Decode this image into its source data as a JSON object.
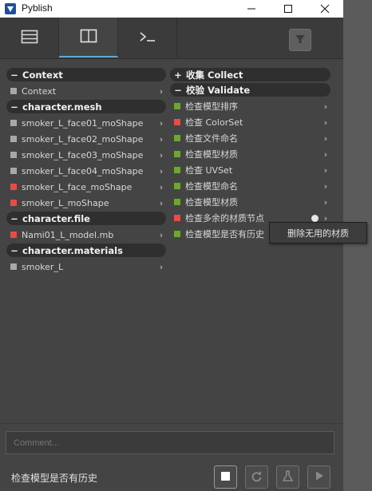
{
  "window": {
    "title": "Pyblish"
  },
  "left": {
    "sections": [
      {
        "label": "Context",
        "items": [
          {
            "label": "Context",
            "status": "gray"
          }
        ]
      },
      {
        "label": "character.mesh",
        "items": [
          {
            "label": "smoker_L_face01_moShape",
            "status": "gray"
          },
          {
            "label": "smoker_L_face02_moShape",
            "status": "gray"
          },
          {
            "label": "smoker_L_face03_moShape",
            "status": "gray"
          },
          {
            "label": "smoker_L_face04_moShape",
            "status": "gray"
          },
          {
            "label": "smoker_L_face_moShape",
            "status": "red"
          },
          {
            "label": "smoker_L_moShape",
            "status": "red"
          }
        ]
      },
      {
        "label": "character.file",
        "items": [
          {
            "label": "Nami01_L_model.mb",
            "status": "red"
          }
        ]
      },
      {
        "label": "character.materials",
        "items": [
          {
            "label": "smoker_L",
            "status": "gray"
          }
        ]
      }
    ]
  },
  "right": {
    "collect_label": "收集 Collect",
    "validate_label": "校验 Validate",
    "items": [
      {
        "label": "检查模型排序",
        "status": "green"
      },
      {
        "label": "检查 ColorSet",
        "status": "red"
      },
      {
        "label": "检查文件命名",
        "status": "green"
      },
      {
        "label": "检查模型材质",
        "status": "green"
      },
      {
        "label": "检查 UVSet",
        "status": "green"
      },
      {
        "label": "检查模型命名",
        "status": "green"
      },
      {
        "label": "检查模型材质",
        "status": "green"
      },
      {
        "label": "检查多余的材质节点",
        "status": "red",
        "info": true
      },
      {
        "label": "检查模型是否有历史",
        "status": "green"
      }
    ]
  },
  "tooltip": {
    "text": "删除无用的材质"
  },
  "comment": {
    "placeholder": "Comment..."
  },
  "status_text": "检查模型是否有历史",
  "colors": {
    "accent": "#5eaad8",
    "fail": "#e74c4c",
    "pass": "#6ea72a",
    "pending": "#a8a8a8"
  }
}
